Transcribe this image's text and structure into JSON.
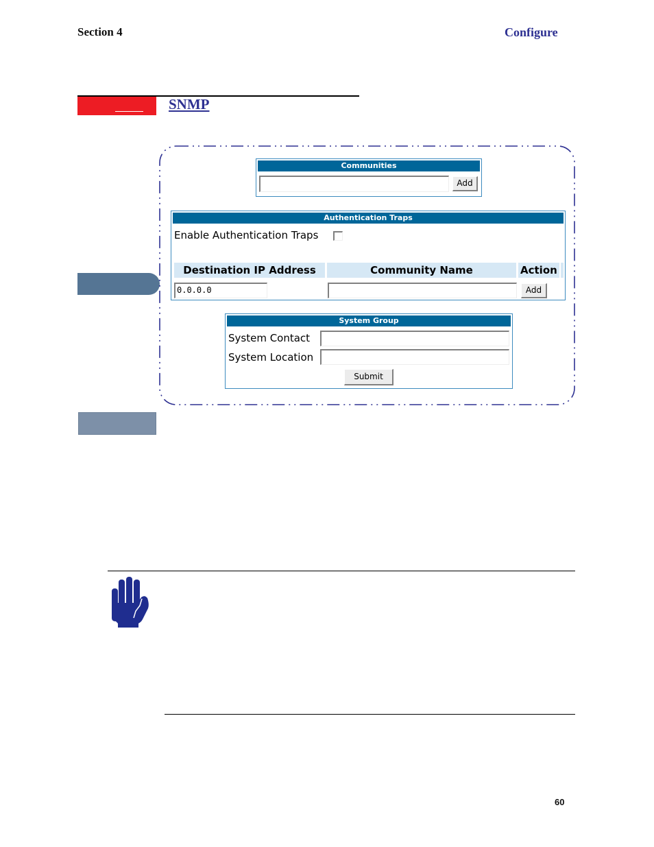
{
  "header": {
    "section": "Section 4",
    "chapter": "Configure"
  },
  "title": {
    "text": "SNMP",
    "accent_color": "#ed1c24",
    "title_color": "#2e3192"
  },
  "communities": {
    "heading": "Communities",
    "community_value": "",
    "add_label": "Add"
  },
  "auth_traps": {
    "heading": "Authentication Traps",
    "enable_label": "Enable Authentication Traps",
    "enable_checked": false,
    "columns": [
      "Destination IP Address",
      "Community Name",
      "Action"
    ],
    "destination_ip_value": "0.0.0.0",
    "community_name_value": "",
    "add_label": "Add"
  },
  "system_group": {
    "heading": "System Group",
    "contact_label": "System Contact",
    "contact_value": "",
    "location_label": "System Location",
    "location_value": "",
    "submit_label": "Submit"
  },
  "colors": {
    "panel_header": "#006699",
    "column_header": "#d6e8f5",
    "frame_dash": "#2e3192",
    "tab_upper": "#557594",
    "tab_lower": "#7d90a8",
    "hand_icon": "#1f2d8f"
  },
  "footer": {
    "page_number": "60"
  }
}
